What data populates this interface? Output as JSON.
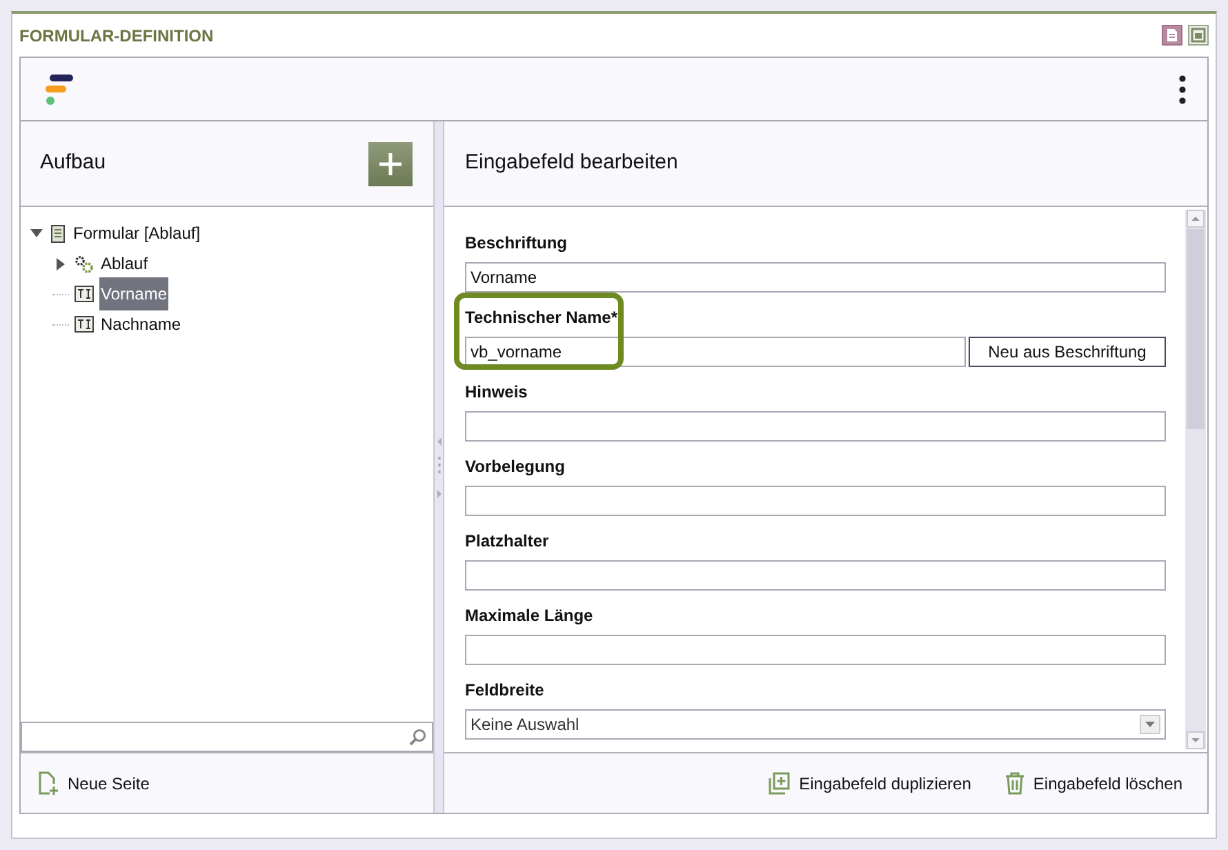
{
  "window": {
    "title": "FORMULAR-DEFINITION"
  },
  "structure_panel": {
    "title": "Aufbau",
    "tree": [
      {
        "label": "Formular [Ablauf]",
        "kind": "form",
        "expanded": true,
        "selected": false,
        "children": [
          {
            "label": "Ablauf",
            "kind": "process",
            "expanded": false,
            "selected": false
          },
          {
            "label": "Vorname",
            "kind": "field",
            "selected": true
          },
          {
            "label": "Nachname",
            "kind": "field",
            "selected": false
          }
        ]
      }
    ],
    "footer_button": "Neue Seite"
  },
  "editor_panel": {
    "title": "Eingabefeld bearbeiten",
    "fields": [
      {
        "label": "Beschriftung",
        "kind": "text",
        "value": "Vorname",
        "highlighted": false
      },
      {
        "label": "Technischer Name*",
        "kind": "text_with_button",
        "value": "vb_vorname",
        "button": "Neu aus Beschriftung",
        "highlighted": true
      },
      {
        "label": "Hinweis",
        "kind": "text",
        "highlighted": false
      },
      {
        "label": "Vorbelegung",
        "kind": "text",
        "highlighted": false
      },
      {
        "label": "Platzhalter",
        "kind": "text",
        "highlighted": false
      },
      {
        "label": "Maximale Länge",
        "kind": "text",
        "highlighted": false
      },
      {
        "label": "Feldbreite",
        "kind": "select",
        "value": "Keine Auswahl",
        "highlighted": false
      }
    ],
    "actions": [
      {
        "label": "Eingabefeld duplizieren",
        "kind": "duplicate"
      },
      {
        "label": "Eingabefeld löschen",
        "kind": "delete"
      }
    ]
  }
}
